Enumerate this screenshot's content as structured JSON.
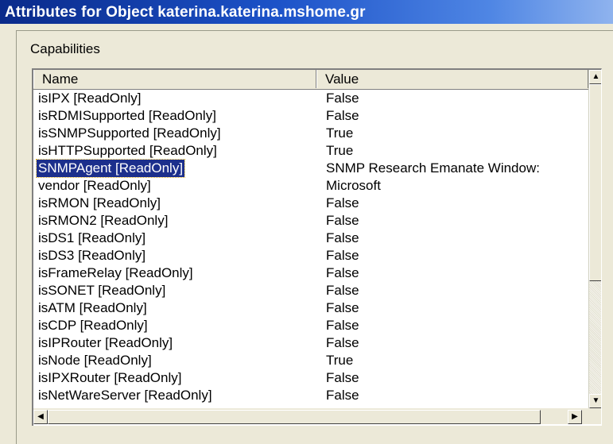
{
  "window": {
    "title": "Attributes for Object katerina.katerina.mshome.gr"
  },
  "group": {
    "label": "Capabilities"
  },
  "list": {
    "columns": {
      "name": "Name",
      "value": "Value"
    },
    "rows": [
      {
        "name": "isIPX [ReadOnly]",
        "value": "False"
      },
      {
        "name": "isRDMISupported [ReadOnly]",
        "value": "False"
      },
      {
        "name": "isSNMPSupported [ReadOnly]",
        "value": "True"
      },
      {
        "name": "isHTTPSupported [ReadOnly]",
        "value": "True"
      },
      {
        "name": "SNMPAgent [ReadOnly]",
        "value": "SNMP Research Emanate Window:"
      },
      {
        "name": "vendor [ReadOnly]",
        "value": "Microsoft"
      },
      {
        "name": "isRMON [ReadOnly]",
        "value": "False"
      },
      {
        "name": "isRMON2 [ReadOnly]",
        "value": "False"
      },
      {
        "name": "isDS1 [ReadOnly]",
        "value": "False"
      },
      {
        "name": "isDS3 [ReadOnly]",
        "value": "False"
      },
      {
        "name": "isFrameRelay [ReadOnly]",
        "value": "False"
      },
      {
        "name": "isSONET [ReadOnly]",
        "value": "False"
      },
      {
        "name": "isATM [ReadOnly]",
        "value": "False"
      },
      {
        "name": "isCDP [ReadOnly]",
        "value": "False"
      },
      {
        "name": "isIPRouter [ReadOnly]",
        "value": "False"
      },
      {
        "name": "isNode [ReadOnly]",
        "value": "True"
      },
      {
        "name": "isIPXRouter [ReadOnly]",
        "value": "False"
      },
      {
        "name": "isNetWareServer [ReadOnly]",
        "value": "False"
      }
    ],
    "selected_index": 4
  },
  "scrollbar": {
    "up_icon": "up-arrow-icon",
    "down_icon": "down-arrow-icon",
    "left_icon": "left-arrow-icon",
    "right_icon": "right-arrow-icon"
  },
  "colors": {
    "title_start": "#0a2a8a",
    "title_end": "#8fb3ee",
    "selection": "#1c2f8c"
  }
}
